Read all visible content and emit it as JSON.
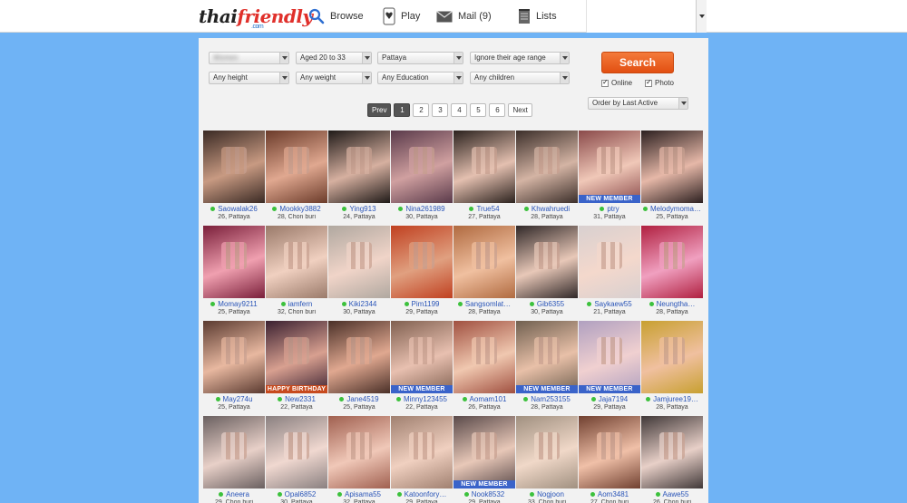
{
  "brand": {
    "name_a": "thai",
    "name_b": "friendly",
    "domain": ".com"
  },
  "nav": {
    "browse": "Browse",
    "play": "Play",
    "mail": "Mail (9)",
    "lists": "Lists"
  },
  "filters": {
    "row1": [
      "",
      "Aged 20 to 33",
      "Pattaya",
      "Ignore their age range"
    ],
    "row2": [
      "Any height",
      "Any weight",
      "Any Education",
      "Any children"
    ],
    "search_label": "Search",
    "online_label": "Online",
    "photo_label": "Photo",
    "order_label": "Order by Last Active"
  },
  "pager": {
    "prev": "Prev",
    "pages": [
      "1",
      "2",
      "3",
      "4",
      "5",
      "6"
    ],
    "next": "Next",
    "current": "1"
  },
  "colors": {
    "background": "#6fb3f5",
    "accent": "#e8581b",
    "link": "#2a55b8",
    "online": "#3cc13c"
  },
  "profiles": [
    {
      "name": "Saowalak26",
      "meta": "26, Pattaya",
      "badge": ""
    },
    {
      "name": "Mookky3882",
      "meta": "28, Chon buri",
      "badge": ""
    },
    {
      "name": "Ying913",
      "meta": "24, Pattaya",
      "badge": ""
    },
    {
      "name": "Nina261989",
      "meta": "30, Pattaya",
      "badge": ""
    },
    {
      "name": "True54",
      "meta": "27, Pattaya",
      "badge": ""
    },
    {
      "name": "Khwahruedi",
      "meta": "28, Pattaya",
      "badge": ""
    },
    {
      "name": "ptry",
      "meta": "31, Pattaya",
      "badge": "NEW MEMBER"
    },
    {
      "name": "Melodymoma…",
      "meta": "25, Pattaya",
      "badge": ""
    },
    {
      "name": "Momay9211",
      "meta": "25, Pattaya",
      "badge": ""
    },
    {
      "name": "iamfern",
      "meta": "32, Chon buri",
      "badge": ""
    },
    {
      "name": "Kiki2344",
      "meta": "30, Pattaya",
      "badge": ""
    },
    {
      "name": "Pim1199",
      "meta": "29, Pattaya",
      "badge": ""
    },
    {
      "name": "Sangsomlat…",
      "meta": "28, Pattaya",
      "badge": ""
    },
    {
      "name": "Gib6355",
      "meta": "30, Pattaya",
      "badge": ""
    },
    {
      "name": "Saykaew55",
      "meta": "21, Pattaya",
      "badge": ""
    },
    {
      "name": "Neungtha…",
      "meta": "28, Pattaya",
      "badge": ""
    },
    {
      "name": "May274u",
      "meta": "25, Pattaya",
      "badge": ""
    },
    {
      "name": "New2331",
      "meta": "22, Pattaya",
      "badge": "HAPPY BIRTHDAY"
    },
    {
      "name": "Jane4519",
      "meta": "25, Pattaya",
      "badge": ""
    },
    {
      "name": "Minny123455",
      "meta": "22, Pattaya",
      "badge": "NEW MEMBER"
    },
    {
      "name": "Aomam101",
      "meta": "26, Pattaya",
      "badge": ""
    },
    {
      "name": "Nam253155",
      "meta": "28, Pattaya",
      "badge": "NEW MEMBER"
    },
    {
      "name": "Jaja7194",
      "meta": "29, Pattaya",
      "badge": "NEW MEMBER"
    },
    {
      "name": "Jamjuree19…",
      "meta": "28, Pattaya",
      "badge": ""
    },
    {
      "name": "Aneera",
      "meta": "29, Chon buri",
      "badge": ""
    },
    {
      "name": "Opal6852",
      "meta": "30, Pattaya",
      "badge": ""
    },
    {
      "name": "Apisama55",
      "meta": "32, Pattaya",
      "badge": ""
    },
    {
      "name": "Katoonfory…",
      "meta": "29, Pattaya",
      "badge": ""
    },
    {
      "name": "Nook8532",
      "meta": "29, Pattaya",
      "badge": "NEW MEMBER"
    },
    {
      "name": "Nogjoon",
      "meta": "33, Chon buri",
      "badge": ""
    },
    {
      "name": "Aom3481",
      "meta": "27, Chon buri",
      "badge": ""
    },
    {
      "name": "Aawe55",
      "meta": "26, Chon buri",
      "badge": ""
    }
  ]
}
